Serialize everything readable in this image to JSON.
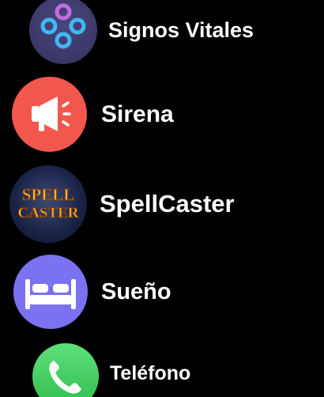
{
  "apps": [
    {
      "label": "Signos Vitales",
      "icon": "vital-signs-icon",
      "color": "#3d3a6b"
    },
    {
      "label": "Sirena",
      "icon": "siren-megaphone-icon",
      "color": "#f2574d"
    },
    {
      "label": "SpellCaster",
      "icon": "spellcaster-logo-icon",
      "color": "#1d2850",
      "icon_text": [
        "SPELL",
        "CASTER"
      ]
    },
    {
      "label": "Sueño",
      "icon": "bed-icon",
      "color": "#7a72f0"
    },
    {
      "label": "Teléfono",
      "icon": "phone-icon",
      "color": "#3dc95a"
    }
  ]
}
